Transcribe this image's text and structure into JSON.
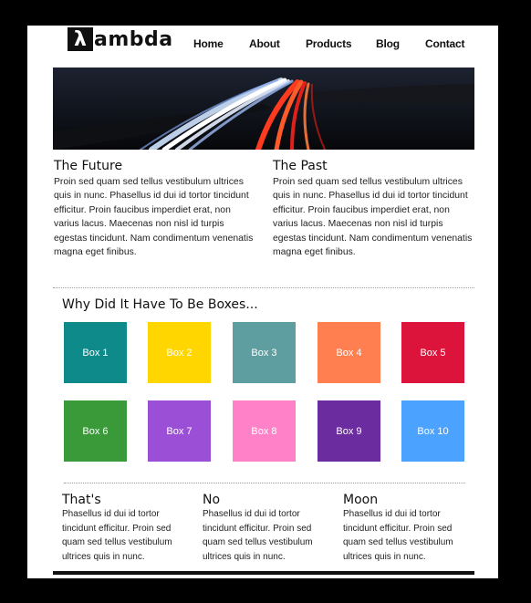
{
  "logo": {
    "mark": "λ",
    "text": "ambda"
  },
  "nav": [
    "Home",
    "About",
    "Products",
    "Blog",
    "Contact"
  ],
  "articles": [
    {
      "title": "The Future",
      "body": "Proin sed quam sed tellus vestibulum ultrices quis in nunc. Phasellus id dui id tortor tincidunt efficitur. Proin faucibus imperdiet erat, non varius lacus. Maecenas non nisl id turpis egestas tincidunt. Nam condimentum venenatis magna eget finibus."
    },
    {
      "title": "The Past",
      "body": "Proin sed quam sed tellus vestibulum ultrices quis in nunc. Phasellus id dui id tortor tincidunt efficitur. Proin faucibus imperdiet erat, non varius lacus. Maecenas non nisl id turpis egestas tincidunt. Nam condimentum venenatis magna eget finibus."
    }
  ],
  "boxes_title": "Why Did It Have To Be Boxes...",
  "boxes": [
    {
      "label": "Box 1",
      "color": "#0E8A8A"
    },
    {
      "label": "Box 2",
      "color": "#FFD600"
    },
    {
      "label": "Box 3",
      "color": "#5F9EA0"
    },
    {
      "label": "Box 4",
      "color": "#FF7F50"
    },
    {
      "label": "Box 5",
      "color": "#DC143C"
    },
    {
      "label": "Box 6",
      "color": "#3A9A3A"
    },
    {
      "label": "Box 7",
      "color": "#9B4FD6"
    },
    {
      "label": "Box 8",
      "color": "#FF82C8"
    },
    {
      "label": "Box 9",
      "color": "#6A2C9E"
    },
    {
      "label": "Box 10",
      "color": "#4CA3FF"
    }
  ],
  "columns": [
    {
      "title": "That's",
      "body": "Phasellus id dui id tortor tincidunt efficitur. Proin sed quam sed tellus vestibulum ultrices quis in nunc."
    },
    {
      "title": "No",
      "body": "Phasellus id dui id tortor tincidunt efficitur. Proin sed quam sed tellus vestibulum ultrices quis in nunc."
    },
    {
      "title": "Moon",
      "body": "Phasellus id dui id tortor tincidunt efficitur. Proin sed quam sed tellus vestibulum ultrices quis in nunc."
    }
  ]
}
